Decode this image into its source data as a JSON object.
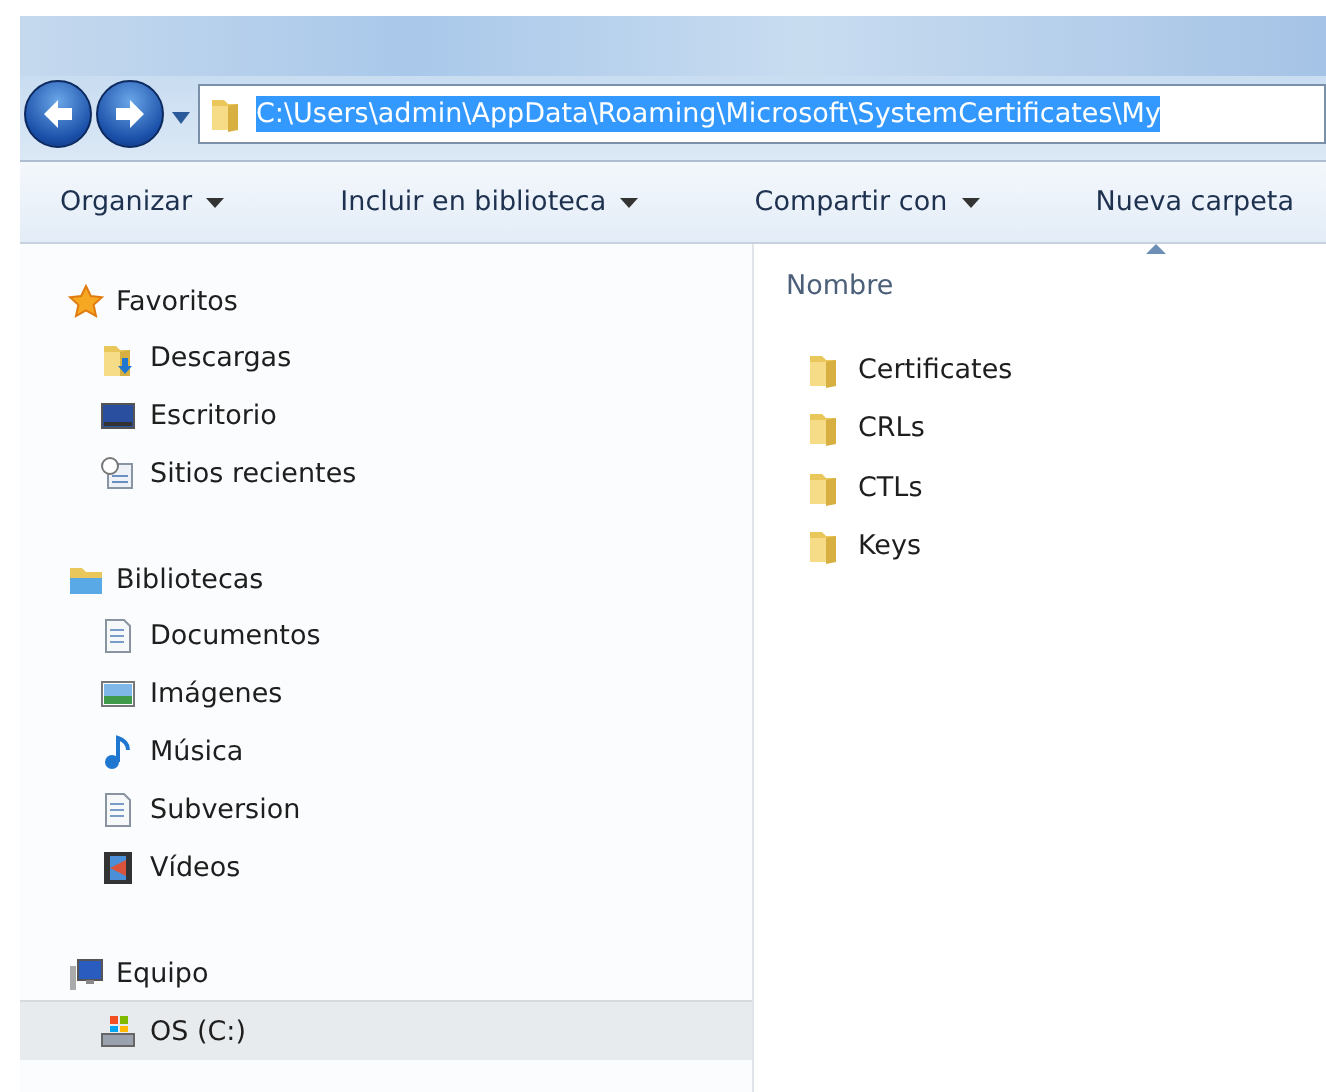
{
  "address_bar": {
    "path": "C:\\Users\\admin\\AppData\\Roaming\\Microsoft\\SystemCertificates\\My",
    "selected": true
  },
  "toolbar": [
    {
      "label": "Organizar",
      "dropdown": true
    },
    {
      "label": "Incluir en biblioteca",
      "dropdown": true
    },
    {
      "label": "Compartir con",
      "dropdown": true
    },
    {
      "label": "Nueva carpeta",
      "dropdown": false
    }
  ],
  "sidebar": {
    "sections": [
      {
        "label": "Favoritos",
        "kind": "star",
        "children": [
          {
            "label": "Descargas",
            "kind": "downloads",
            "selected": false
          },
          {
            "label": "Escritorio",
            "kind": "desktop",
            "selected": false
          },
          {
            "label": "Sitios recientes",
            "kind": "recent",
            "selected": false
          }
        ]
      },
      {
        "label": "Bibliotecas",
        "kind": "library",
        "children": [
          {
            "label": "Documentos",
            "kind": "document",
            "selected": false
          },
          {
            "label": "Imágenes",
            "kind": "image",
            "selected": false
          },
          {
            "label": "Música",
            "kind": "music",
            "selected": false
          },
          {
            "label": "Subversion",
            "kind": "document",
            "selected": false
          },
          {
            "label": "Vídeos",
            "kind": "video",
            "selected": false
          }
        ]
      },
      {
        "label": "Equipo",
        "kind": "computer",
        "children": [
          {
            "label": "OS (C:)",
            "kind": "drive",
            "selected": true
          }
        ]
      }
    ]
  },
  "content": {
    "column": {
      "label": "Nombre",
      "sorted_ascending": true
    },
    "items": [
      {
        "name": "Certificates"
      },
      {
        "name": "CRLs"
      },
      {
        "name": "CTLs"
      },
      {
        "name": "Keys"
      }
    ]
  }
}
